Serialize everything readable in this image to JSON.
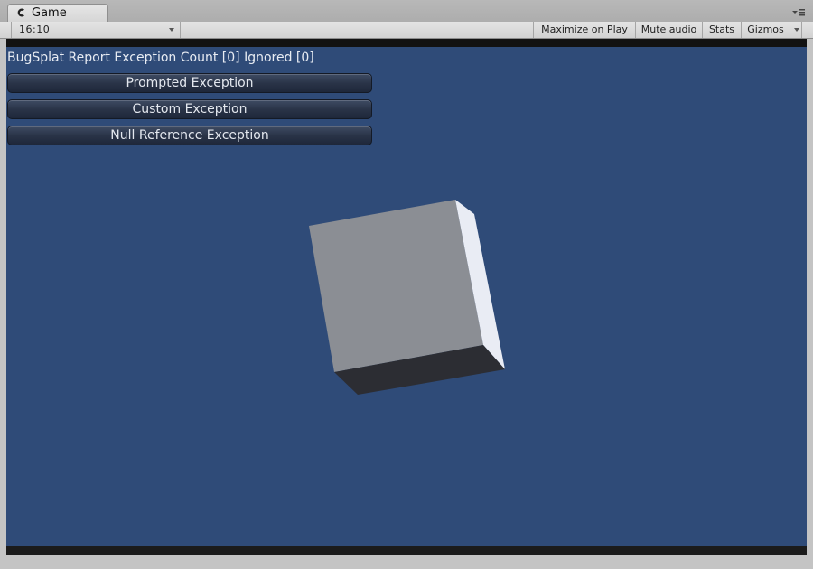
{
  "window": {
    "tab_label": "Game",
    "tab_icon": "game-view-icon",
    "tab_menu_icon": "tab-menu-icon"
  },
  "toolbar": {
    "aspect_ratio": "16:10",
    "maximize_label": "Maximize on Play",
    "mute_label": "Mute audio",
    "stats_label": "Stats",
    "gizmos_label": "Gizmos"
  },
  "game": {
    "counter_label": "BugSplat Report Exception Count [0] Ignored [0]",
    "buttons": [
      {
        "label": "Prompted Exception"
      },
      {
        "label": "Custom Exception"
      },
      {
        "label": "Null Reference Exception"
      }
    ]
  },
  "colors": {
    "background": "#2f4b78",
    "cube_front": "#8b8e94",
    "cube_side": "#e9ecf4",
    "cube_bottom": "#2c2d33"
  }
}
